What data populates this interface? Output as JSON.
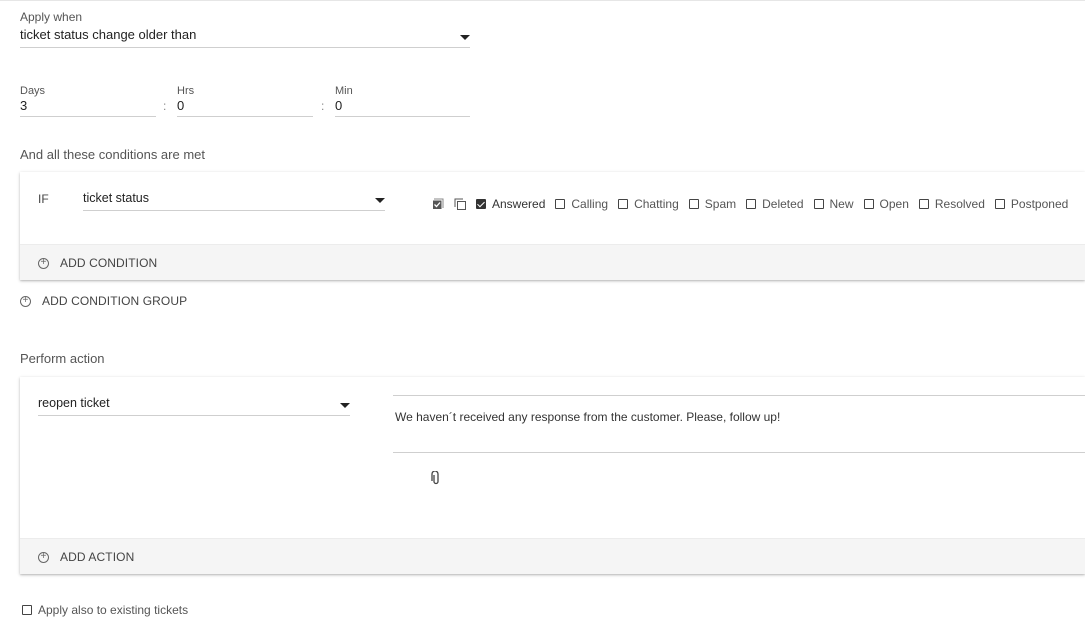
{
  "trigger": {
    "label": "Apply when",
    "value": "ticket status change older than"
  },
  "time": {
    "days_label": "Days",
    "days_value": "3",
    "hrs_label": "Hrs",
    "hrs_value": "0",
    "min_label": "Min",
    "min_value": "0",
    "separator": ":"
  },
  "conditions": {
    "title": "And all these conditions are met",
    "if_label": "IF",
    "field_value": "ticket status",
    "select_all_icon": "select-all-icon",
    "copy_icon": "copy-icon",
    "options": [
      {
        "label": "Answered",
        "checked": true
      },
      {
        "label": "Calling",
        "checked": false
      },
      {
        "label": "Chatting",
        "checked": false
      },
      {
        "label": "Spam",
        "checked": false
      },
      {
        "label": "Deleted",
        "checked": false
      },
      {
        "label": "New",
        "checked": false
      },
      {
        "label": "Open",
        "checked": false
      },
      {
        "label": "Resolved",
        "checked": false
      },
      {
        "label": "Postponed",
        "checked": false
      }
    ],
    "add_condition": "ADD CONDITION",
    "add_condition_group": "ADD CONDITION GROUP"
  },
  "actions": {
    "title": "Perform action",
    "action_value": "reopen ticket",
    "message": "We haven´t received any response from the customer. Please, follow up!",
    "attach_icon": "paperclip-icon",
    "add_action": "ADD ACTION"
  },
  "footer": {
    "apply_existing_label": "Apply also to existing tickets",
    "apply_existing_checked": false
  }
}
